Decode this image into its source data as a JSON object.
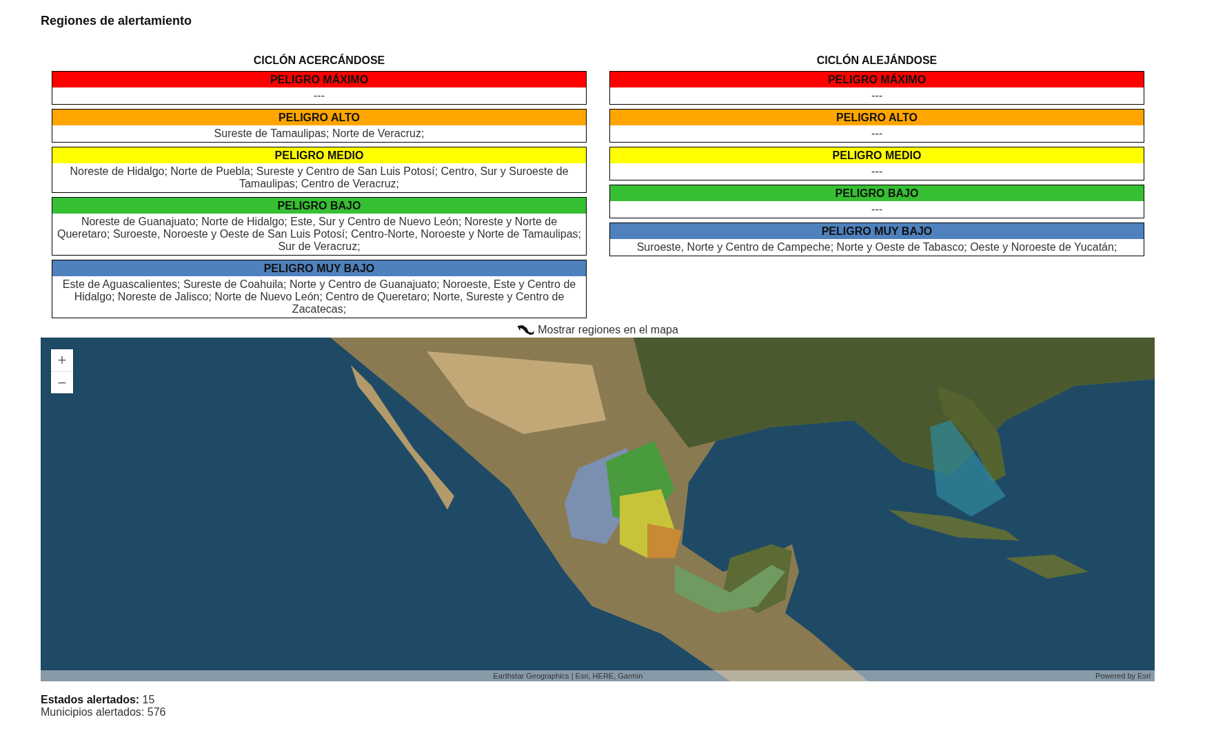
{
  "title": "Regiones de alertamiento",
  "panels": [
    {
      "heading": "CICLÓN ACERCÁNDOSE",
      "levels": [
        {
          "label": "PELIGRO MÁXIMO",
          "color": "#ff0000",
          "regions": "---"
        },
        {
          "label": "PELIGRO ALTO",
          "color": "#ffa500",
          "regions": "Sureste de Tamaulipas; Norte de Veracruz;"
        },
        {
          "label": "PELIGRO MEDIO",
          "color": "#ffff00",
          "regions": "Noreste de Hidalgo; Norte de Puebla; Sureste y Centro de San Luis Potosí; Centro, Sur y Suroeste de Tamaulipas; Centro de Veracruz;"
        },
        {
          "label": "PELIGRO BAJO",
          "color": "#36bf32",
          "regions": "Noreste de Guanajuato; Norte de Hidalgo; Este, Sur y Centro de Nuevo León; Noreste y Norte de Queretaro; Suroeste, Noroeste y Oeste de San Luis Potosí; Centro-Norte, Noroeste y Norte de Tamaulipas; Sur de Veracruz;"
        },
        {
          "label": "PELIGRO MUY BAJO",
          "color": "#4f81bd",
          "regions": "Este de Aguascalientes; Sureste de Coahuila; Norte y Centro de Guanajuato; Noroeste, Este y Centro de Hidalgo; Noreste de Jalisco; Norte de Nuevo León; Centro de Queretaro; Norte, Sureste y Centro de Zacatecas;"
        }
      ]
    },
    {
      "heading": "CICLÓN ALEJÁNDOSE",
      "levels": [
        {
          "label": "PELIGRO MÁXIMO",
          "color": "#ff0000",
          "regions": "---"
        },
        {
          "label": "PELIGRO ALTO",
          "color": "#ffa500",
          "regions": "---"
        },
        {
          "label": "PELIGRO MEDIO",
          "color": "#ffff00",
          "regions": "---"
        },
        {
          "label": "PELIGRO BAJO",
          "color": "#36bf32",
          "regions": "---"
        },
        {
          "label": "PELIGRO MUY BAJO",
          "color": "#4f81bd",
          "regions": "Suroeste, Norte y Centro de Campeche; Norte y Oeste de Tabasco; Oeste y Noroeste de Yucatán;"
        }
      ]
    }
  ],
  "map": {
    "toggle_label": "Mostrar regiones en el mapa",
    "zoom_in": "+",
    "zoom_out": "−",
    "attribution": "Earthstar Geographics | Esri, HERE, Garmin",
    "powered_by": "Powered by Esri"
  },
  "stats": [
    "**Estados alertados:** 15",
    "Municipios alertados: 576"
  ]
}
